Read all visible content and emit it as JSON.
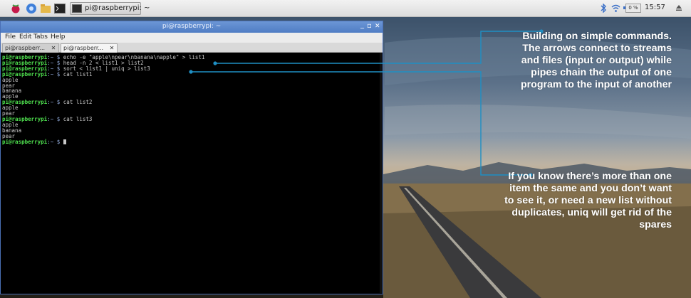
{
  "taskbar": {
    "window_button_label": "pi@raspberrypi: ~",
    "tray": {
      "bluetooth_icon": "bluetooth-icon",
      "wifi_icon": "wifi-icon",
      "volume_icon": "volume-icon",
      "cpu_label": "0 %",
      "time": "15:57",
      "eject_icon": "eject-icon"
    }
  },
  "window": {
    "title": "pi@raspberrypi: ~",
    "controls": {
      "minimize": "_",
      "maximize": "▫",
      "close": "✕"
    },
    "menu": [
      "File",
      "Edit",
      "Tabs",
      "Help"
    ],
    "tabs": [
      {
        "label": "pi@raspberr...",
        "close": "✕"
      },
      {
        "label": "pi@raspberr...",
        "close": "✕"
      }
    ]
  },
  "terminal": {
    "prompt": "pi@raspberrypi",
    "path": ":~ $",
    "lines": [
      {
        "type": "cmd",
        "text": " echo -e \"apple\\npear\\nbanana\\napple\" > list1"
      },
      {
        "type": "cmd",
        "text": " head -n 2 < list1 > list2"
      },
      {
        "type": "cmd",
        "text": " sort < list1 | uniq > list3"
      },
      {
        "type": "cmd",
        "text": " cat list1"
      },
      {
        "type": "out",
        "text": "apple"
      },
      {
        "type": "out",
        "text": "pear"
      },
      {
        "type": "out",
        "text": "banana"
      },
      {
        "type": "out",
        "text": "apple"
      },
      {
        "type": "cmd",
        "text": " cat list2"
      },
      {
        "type": "out",
        "text": "apple"
      },
      {
        "type": "out",
        "text": "pear"
      },
      {
        "type": "cmd",
        "text": " cat list3"
      },
      {
        "type": "out",
        "text": "apple"
      },
      {
        "type": "out",
        "text": "banana"
      },
      {
        "type": "out",
        "text": "pear"
      },
      {
        "type": "cursor",
        "text": " "
      }
    ]
  },
  "annotations": [
    "Building on simple commands. The arrows connect to streams and files (input or output) while pipes chain the output of one program to the input of another",
    "If you know there’s more than one item the same and you don’t want to see it, or need a new list without duplicates, uniq will get rid of the spares"
  ],
  "colors": {
    "accent": "#4f7dc4",
    "prompt_green": "#4ee04e",
    "annotation_line": "#1f8fc4"
  }
}
